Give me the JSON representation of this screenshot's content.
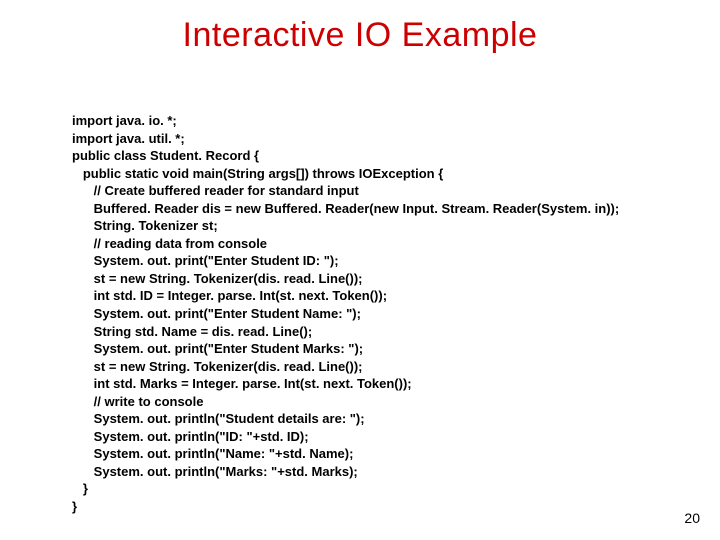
{
  "title": "Interactive IO Example",
  "code": {
    "l1": "import java. io. *;",
    "l2": "import java. util. *;",
    "l3": "public class Student. Record {",
    "l4": "   public static void main(String args[]) throws IOException {",
    "l5": "      // Create buffered reader for standard input",
    "l6": "      Buffered. Reader dis = new Buffered. Reader(new Input. Stream. Reader(System. in));",
    "l7": "      String. Tokenizer st;",
    "l8": "      // reading data from console",
    "l9": "      System. out. print(\"Enter Student ID: \");",
    "l10": "      st = new String. Tokenizer(dis. read. Line());",
    "l11": "      int std. ID = Integer. parse. Int(st. next. Token());",
    "l12": "      System. out. print(\"Enter Student Name: \");",
    "l13": "      String std. Name = dis. read. Line();",
    "l14": "      System. out. print(\"Enter Student Marks: \");",
    "l15": "      st = new String. Tokenizer(dis. read. Line());",
    "l16": "      int std. Marks = Integer. parse. Int(st. next. Token());",
    "l17": "      // write to console",
    "l18": "      System. out. println(\"Student details are: \");",
    "l19": "      System. out. println(\"ID: \"+std. ID);",
    "l20": "      System. out. println(\"Name: \"+std. Name);",
    "l21": "      System. out. println(\"Marks: \"+std. Marks);",
    "l22": "   }",
    "l23": "}"
  },
  "page_number": "20"
}
